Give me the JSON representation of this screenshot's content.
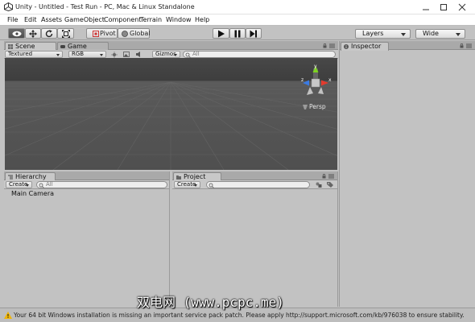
{
  "window": {
    "title": "Unity - Untitled - Test Run - PC, Mac & Linux Standalone"
  },
  "menu": [
    "File",
    "Edit",
    "Assets",
    "GameObject",
    "Component",
    "Terrain",
    "Window",
    "Help"
  ],
  "toolbar": {
    "pivot_label": "Pivot",
    "global_label": "Global",
    "layers_label": "Layers",
    "layout_label": "Wide"
  },
  "scene": {
    "tab_scene": "Scene",
    "tab_game": "Game",
    "shading_mode": "Textured",
    "render_mode": "RGB",
    "gizmos_label": "Gizmos",
    "search_placeholder": "All",
    "persp_label": "Persp",
    "gizmo_axes": {
      "y": "y",
      "x": "x",
      "z": "z"
    }
  },
  "hierarchy": {
    "tab_label": "Hierarchy",
    "create_label": "Create",
    "search_placeholder": "All",
    "items": [
      "Main Camera"
    ]
  },
  "project": {
    "tab_label": "Project",
    "create_label": "Create"
  },
  "inspector": {
    "tab_label": "Inspector"
  },
  "status": {
    "message": "Your 64 bit Windows installation is missing an important service pack patch. Please apply http://support.microsoft.com/kb/976038 to ensure stability."
  },
  "watermark": "双电网 (www.pcpc.me)",
  "colors": {
    "editor_bg": "#c2c2c2",
    "viewport_bg": "#484848",
    "axis_y": "#7ed321",
    "axis_x": "#e33b2e",
    "axis_z": "#3b7be3",
    "warning": "#f0b400"
  }
}
